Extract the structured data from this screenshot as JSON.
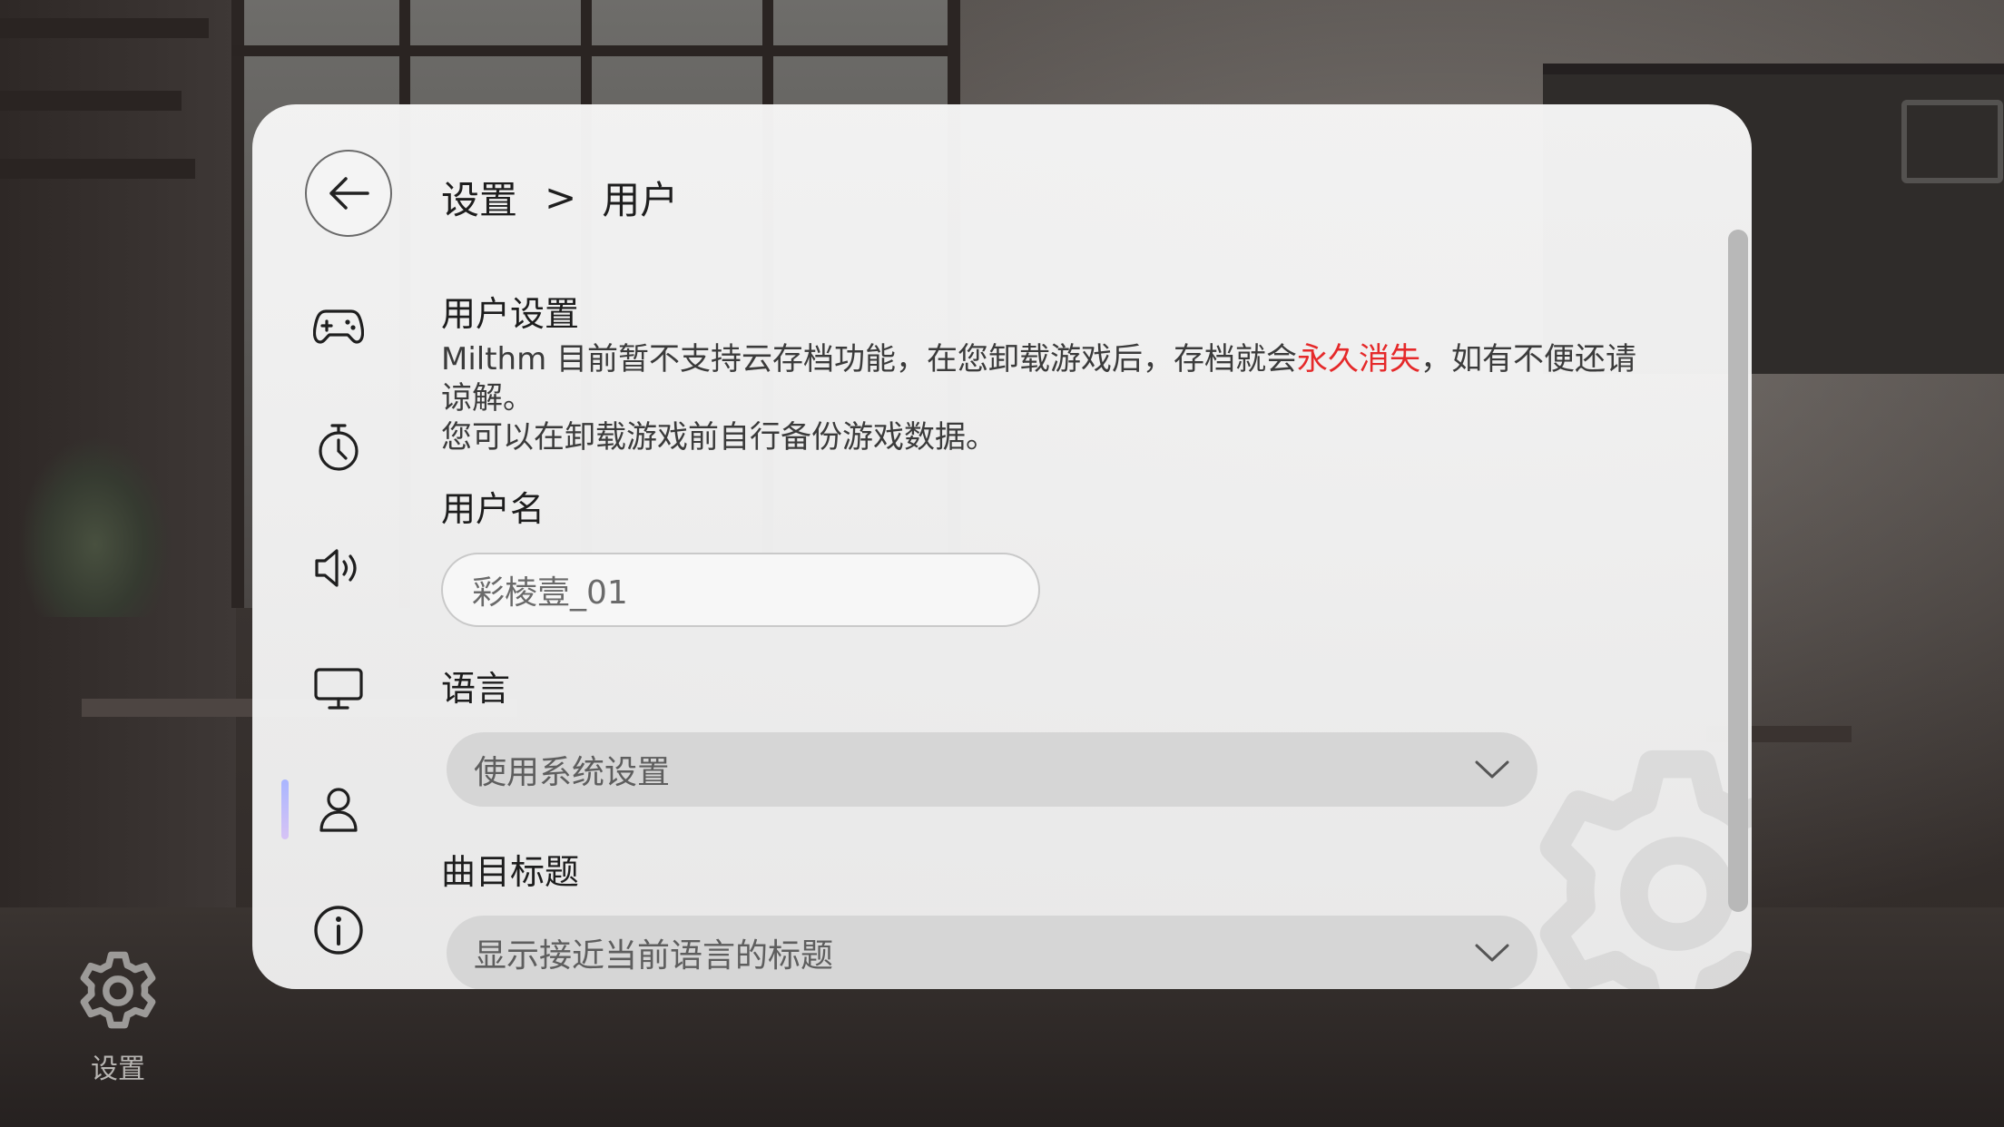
{
  "breadcrumb": {
    "parent": "设置",
    "separator": ">",
    "current": "用户"
  },
  "nav": {
    "items": [
      {
        "icon": "gamepad-icon",
        "active": false
      },
      {
        "icon": "stopwatch-icon",
        "active": false
      },
      {
        "icon": "speaker-icon",
        "active": false
      },
      {
        "icon": "monitor-icon",
        "active": false
      },
      {
        "icon": "user-icon",
        "active": true
      },
      {
        "icon": "info-icon",
        "active": false
      }
    ]
  },
  "user_settings": {
    "title": "用户设置",
    "desc_part1": "Milthm 目前暂不支持云存档功能，在您卸载游戏后，存档就会",
    "desc_warning": "永久消失",
    "desc_part2": "，如有不便还请谅解。",
    "desc_line2": "您可以在卸载游戏前自行备份游戏数据。"
  },
  "username": {
    "label": "用户名",
    "value": "彩棱壹_01"
  },
  "language": {
    "label": "语言",
    "selected": "使用系统设置"
  },
  "song_title": {
    "label": "曲目标题",
    "selected": "显示接近当前语言的标题"
  },
  "corner": {
    "label": "设置",
    "icon": "gear-icon"
  },
  "colors": {
    "accent_indicator": "#a9b6ff",
    "warning": "#e5292a",
    "dropdown_bg": "#d6d6d6"
  }
}
